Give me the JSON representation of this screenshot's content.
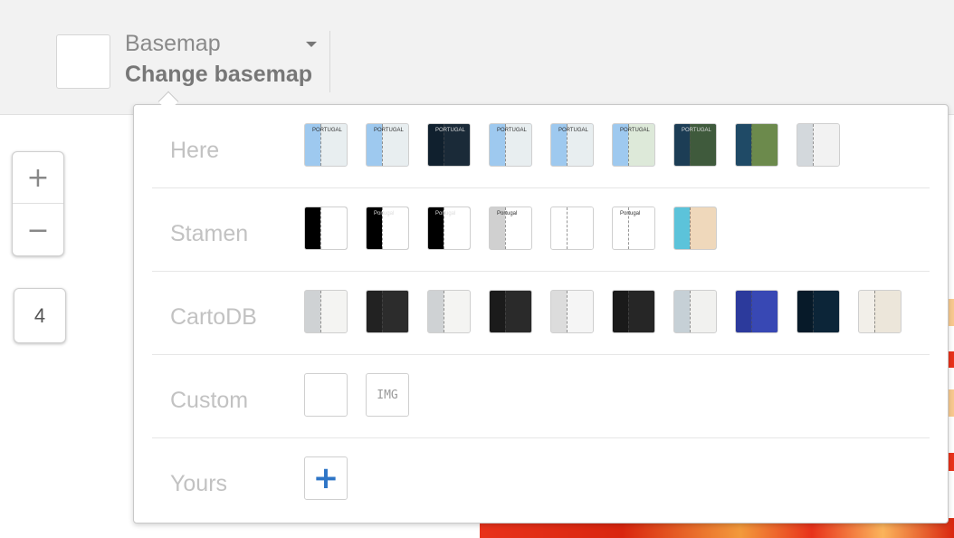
{
  "basemap_selector": {
    "title": "Basemap",
    "subtitle": "Change basemap",
    "caret_icon": "caret-down-icon"
  },
  "zoom": {
    "in_label": "+",
    "out_label": "−",
    "level": "4"
  },
  "sections": [
    {
      "label": "Here",
      "thumbnails": [
        {
          "sea": "#9ec9ef",
          "land": "#e8eef0",
          "tlbl": "PORTUGAL"
        },
        {
          "sea": "#9ec9ef",
          "land": "#e8eef0",
          "tlbl": "PORTUGAL"
        },
        {
          "sea": "#10202e",
          "land": "#1a2a38",
          "tlbl": "PORTUGAL"
        },
        {
          "sea": "#9ec9ef",
          "land": "#e8eef0",
          "tlbl": "PORTUGAL"
        },
        {
          "sea": "#9ec9ef",
          "land": "#e8eef0",
          "tlbl": "PORTUGAL"
        },
        {
          "sea": "#9ec9ef",
          "land": "#dde9d9",
          "tlbl": "PORTUGAL"
        },
        {
          "sea": "#1c3d55",
          "land": "#3f5a3c",
          "tlbl": "PORTUGAL"
        },
        {
          "sea": "#1f4a66",
          "land": "#6c8a4c",
          "tlbl": ""
        },
        {
          "sea": "#d3d8dc",
          "land": "#f2f2f2",
          "tlbl": ""
        }
      ]
    },
    {
      "label": "Stamen",
      "thumbnails": [
        {
          "sea": "#000000",
          "land": "#ffffff",
          "tlbl": ""
        },
        {
          "sea": "#000000",
          "land": "#ffffff",
          "tlbl": "Portugal"
        },
        {
          "sea": "#000000",
          "land": "#ffffff",
          "tlbl": "Portugal"
        },
        {
          "sea": "#d0d0d0",
          "land": "#ffffff",
          "tlbl": "Portugal"
        },
        {
          "sea": "#ffffff",
          "land": "#ffffff",
          "tlbl": ""
        },
        {
          "sea": "#ffffff",
          "land": "#ffffff",
          "tlbl": "Portugal"
        },
        {
          "sea": "#5cc3da",
          "land": "#efd8bb",
          "tlbl": ""
        }
      ]
    },
    {
      "label": "CartoDB",
      "thumbnails": [
        {
          "sea": "#cfd2d4",
          "land": "#f4f4f2",
          "tlbl": ""
        },
        {
          "sea": "#222222",
          "land": "#2c2c2c",
          "tlbl": ""
        },
        {
          "sea": "#cfd2d4",
          "land": "#f4f4f2",
          "tlbl": ""
        },
        {
          "sea": "#1b1b1b",
          "land": "#2a2a2a",
          "tlbl": ""
        },
        {
          "sea": "#dcdcdc",
          "land": "#f5f5f5",
          "tlbl": ""
        },
        {
          "sea": "#1a1a1a",
          "land": "#262626",
          "tlbl": ""
        },
        {
          "sea": "#c6d0d6",
          "land": "#f1f1ef",
          "tlbl": ""
        },
        {
          "sea": "#2c3a9c",
          "land": "#3848b4",
          "tlbl": ""
        },
        {
          "sea": "#071a29",
          "land": "#0c2538",
          "tlbl": ""
        },
        {
          "sea": "#f2efe9",
          "land": "#ece6da",
          "tlbl": ""
        }
      ]
    },
    {
      "label": "Custom",
      "custom_img_label": "IMG"
    },
    {
      "label": "Yours",
      "add_label": "+"
    }
  ]
}
